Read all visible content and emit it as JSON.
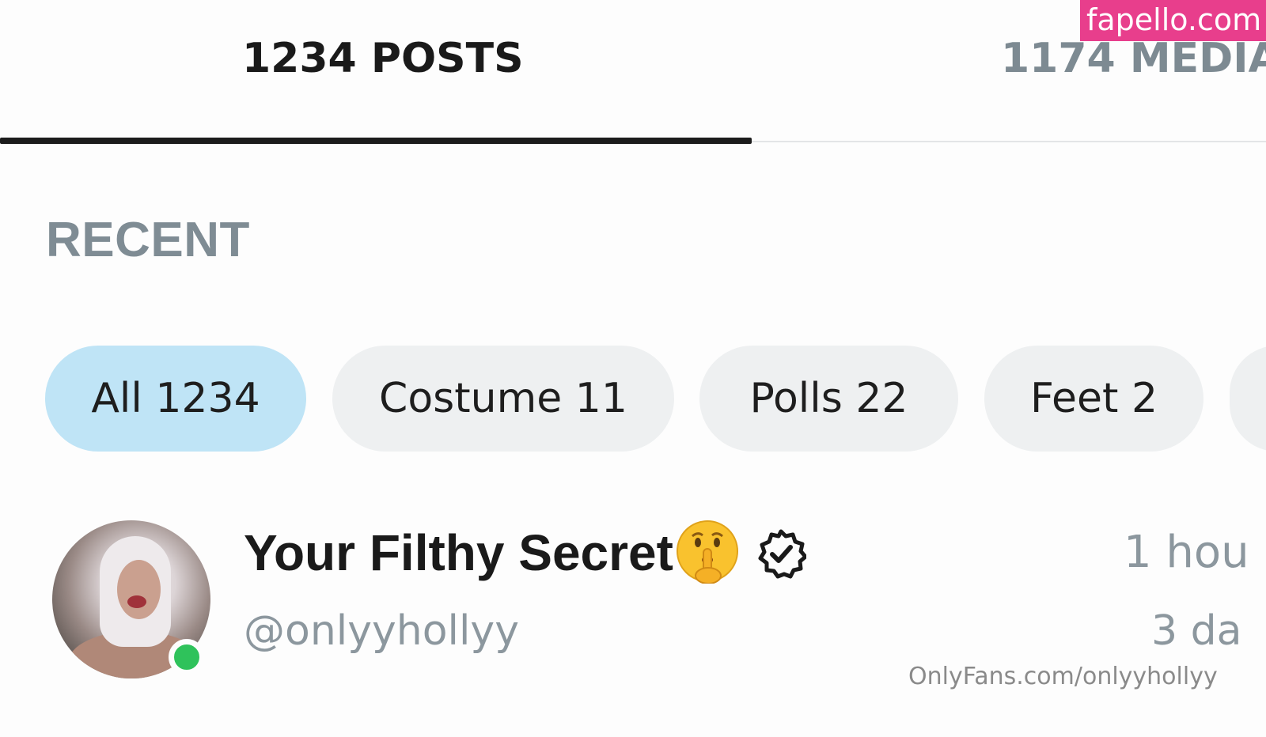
{
  "watermark": {
    "text": "fapello.com"
  },
  "tabs": [
    {
      "label": "1234 POSTS",
      "active": true
    },
    {
      "label": "1174 MEDIA",
      "active": false
    }
  ],
  "section": {
    "title": "RECENT"
  },
  "filters": [
    {
      "label": "All 1234",
      "active": true
    },
    {
      "label": "Costume 11",
      "active": false
    },
    {
      "label": "Polls 22",
      "active": false
    },
    {
      "label": "Feet 2",
      "active": false
    }
  ],
  "post": {
    "display_name": "Your Filthy Secret",
    "emoji_icon": "shushing-face-icon",
    "verified_icon": "verified-badge-icon",
    "handle": "@onlyyhollyy",
    "time_primary": "1 hou",
    "time_secondary": "3 da",
    "online": true
  },
  "footer": {
    "source_url": "OnlyFans.com/onlyyhollyy"
  },
  "colors": {
    "accent_pink": "#e83e8c",
    "active_chip": "#bfe4f6",
    "chip": "#eef0f1",
    "muted_text": "#8c979e",
    "online_green": "#2fc25b"
  }
}
